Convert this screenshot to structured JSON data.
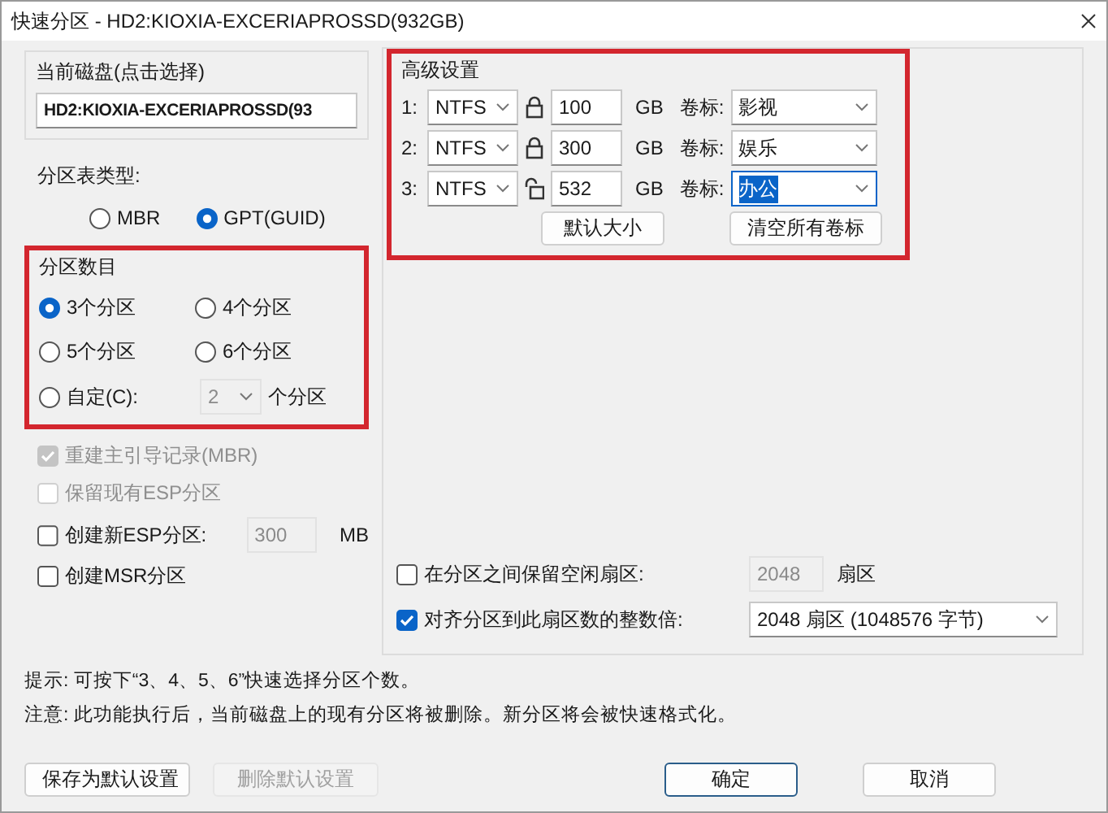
{
  "window": {
    "title": "快速分区 - HD2:KIOXIA-EXCERIAPROSSD(932GB)"
  },
  "current_disk": {
    "label": "当前磁盘(点击选择)",
    "value": "HD2:KIOXIA-EXCERIAPROSSD(93"
  },
  "partition_table": {
    "label": "分区表类型:",
    "options": [
      {
        "label": "MBR",
        "selected": false
      },
      {
        "label": "GPT(GUID)",
        "selected": true
      }
    ]
  },
  "partition_count": {
    "label": "分区数目",
    "options": [
      {
        "label": "3个分区",
        "selected": true
      },
      {
        "label": "4个分区",
        "selected": false
      },
      {
        "label": "5个分区",
        "selected": false
      },
      {
        "label": "6个分区",
        "selected": false
      },
      {
        "label": "自定(C):",
        "selected": false
      }
    ],
    "custom_value": "2",
    "custom_suffix": "个分区"
  },
  "options": [
    {
      "label": "重建主引导记录(MBR)",
      "checked": true,
      "disabled": true
    },
    {
      "label": "保留现有ESP分区",
      "checked": false,
      "disabled": true
    },
    {
      "label": "创建新ESP分区:",
      "checked": false,
      "disabled": false,
      "value": "300",
      "unit": "MB"
    },
    {
      "label": "创建MSR分区",
      "checked": false,
      "disabled": false
    }
  ],
  "advanced": {
    "title": "高级设置",
    "rows": [
      {
        "index": "1:",
        "fs": "NTFS",
        "locked": true,
        "size": "100",
        "unit": "GB",
        "caption": "卷标:",
        "volume": "影视",
        "selected": false
      },
      {
        "index": "2:",
        "fs": "NTFS",
        "locked": true,
        "size": "300",
        "unit": "GB",
        "caption": "卷标:",
        "volume": "娱乐",
        "selected": false
      },
      {
        "index": "3:",
        "fs": "NTFS",
        "locked": false,
        "size": "532",
        "unit": "GB",
        "caption": "卷标:",
        "volume": "办公",
        "selected": true
      }
    ],
    "buttons": [
      "默认大小",
      "清空所有卷标"
    ]
  },
  "gap_option": {
    "label": "在分区之间保留空闲扇区:",
    "checked": false,
    "value": "2048",
    "unit": "扇区"
  },
  "align_option": {
    "label": "对齐分区到此扇区数的整数倍:",
    "checked": true,
    "value": "2048 扇区 (1048576 字节)"
  },
  "notes": [
    "提示: 可按下“3、4、5、6”快速选择分区个数。",
    "注意: 此功能执行后，当前磁盘上的现有分区将被删除。新分区将会被快速格式化。"
  ],
  "footer_buttons": [
    {
      "label": "保存为默认设置",
      "disabled": false,
      "default": false
    },
    {
      "label": "删除默认设置",
      "disabled": true,
      "default": false
    },
    {
      "label": "确定",
      "disabled": false,
      "default": true
    },
    {
      "label": "取消",
      "disabled": false,
      "default": false
    }
  ]
}
